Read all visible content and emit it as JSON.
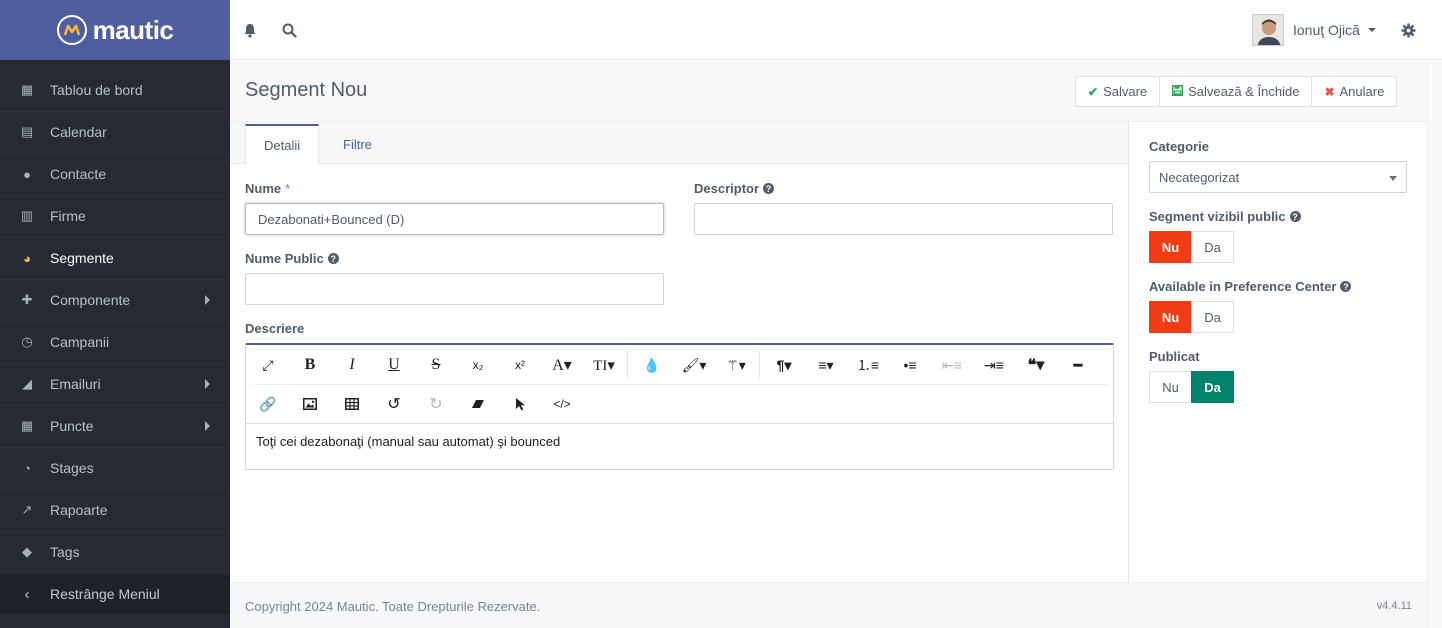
{
  "brand": {
    "name": "mautic"
  },
  "sidebar": {
    "items": [
      {
        "label": "Tablou de bord",
        "icon": "dashboard-icon",
        "glyph": "▦"
      },
      {
        "label": "Calendar",
        "icon": "calendar-icon",
        "glyph": "▤"
      },
      {
        "label": "Contacte",
        "icon": "user-icon",
        "glyph": "●"
      },
      {
        "label": "Firme",
        "icon": "building-icon",
        "glyph": "▥"
      },
      {
        "label": "Segmente",
        "icon": "pie-chart-icon",
        "glyph": "◕"
      },
      {
        "label": "Componente",
        "icon": "puzzle-icon",
        "glyph": "✚"
      },
      {
        "label": "Campanii",
        "icon": "clock-icon",
        "glyph": "◷"
      },
      {
        "label": "Emailuri",
        "icon": "rss-icon",
        "glyph": "◢"
      },
      {
        "label": "Puncte",
        "icon": "calculator-icon",
        "glyph": "▦"
      },
      {
        "label": "Stages",
        "icon": "tachometer-icon",
        "glyph": "◔"
      },
      {
        "label": "Rapoarte",
        "icon": "line-chart-icon",
        "glyph": "↗"
      },
      {
        "label": "Tags",
        "icon": "tag-icon",
        "glyph": "◆"
      }
    ],
    "collapse_label": "Restrânge Meniul"
  },
  "topbar": {
    "user_name": "Ionuţ Ojică"
  },
  "header": {
    "title": "Segment Nou",
    "save_label": "Salvare",
    "save_close_label": "Salvează & Închide",
    "cancel_label": "Anulare"
  },
  "tabs": {
    "details": "Detalii",
    "filters": "Filtre"
  },
  "form": {
    "name_label": "Nume",
    "name_value": "Dezabonati+Bounced (D)",
    "descriptor_label": "Descriptor",
    "descriptor_value": "",
    "public_name_label": "Nume Public",
    "public_name_value": "",
    "description_label": "Descriere",
    "description_value": "Toţi cei dezabonaţi (manual sau automat) şi bounced"
  },
  "side": {
    "category_label": "Categorie",
    "category_value": "Necategorizat",
    "public_label": "Segment vizibil public",
    "preference_label": "Available in Preference Center",
    "published_label": "Publicat",
    "no_label": "Nu",
    "yes_label": "Da"
  },
  "footer": {
    "copyright": "Copyright 2024 Mautic. Toate Drepturile Rezervate.",
    "version": "v4.4.11"
  },
  "colors": {
    "brand": "#4e5e9e",
    "sidebar_bg": "#252a33",
    "toggle_off_red": "#f03c14",
    "toggle_on_green": "#00836b",
    "segment_icon": "#fdb933"
  }
}
